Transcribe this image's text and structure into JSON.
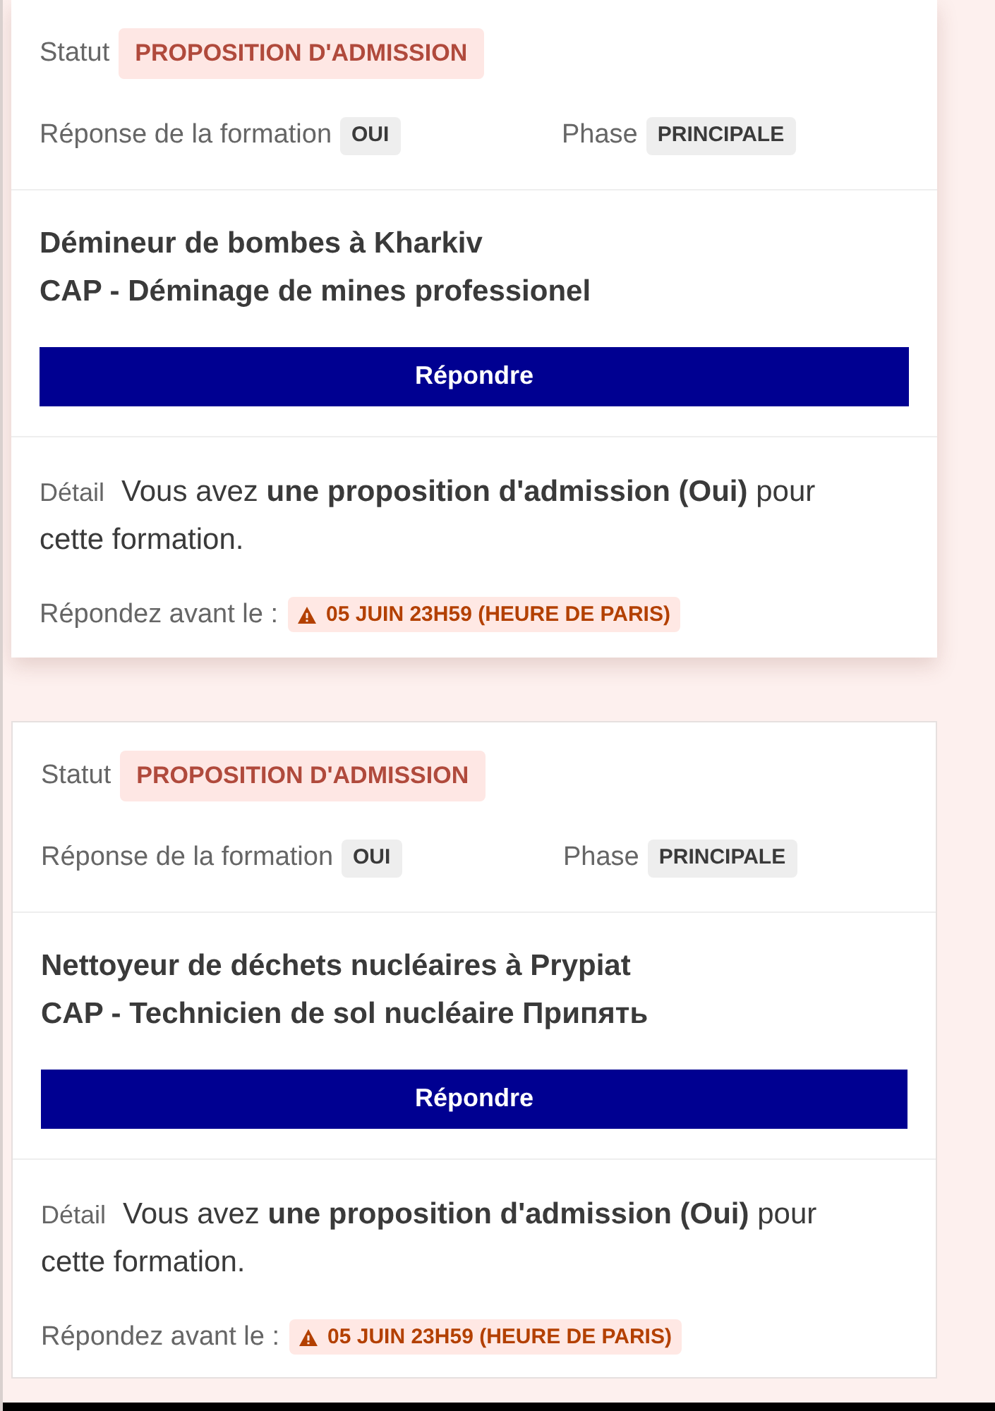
{
  "cards": [
    {
      "raised": true,
      "status": {
        "label": "Statut",
        "value": "PROPOSITION D'ADMISSION"
      },
      "response": {
        "label": "Réponse de la formation",
        "value": "OUI"
      },
      "phase": {
        "label": "Phase",
        "value": "PRINCIPALE"
      },
      "title": "Démineur de bombes à Kharkiv",
      "subtitle": "CAP - Déminage de mines professionel",
      "button": "Répondre",
      "detail": {
        "label": "Détail",
        "message": "Vous avez **une proposition d'admission (Oui)** pour cette formation."
      },
      "deadline": {
        "label": "Répondez avant le :",
        "value": "05 JUIN 23H59 (HEURE DE PARIS)"
      }
    },
    {
      "raised": false,
      "status": {
        "label": "Statut",
        "value": "PROPOSITION D'ADMISSION"
      },
      "response": {
        "label": "Réponse de la formation",
        "value": "OUI"
      },
      "phase": {
        "label": "Phase",
        "value": "PRINCIPALE"
      },
      "title": "Nettoyeur de déchets nucléaires à Prypiat",
      "subtitle": "CAP - Technicien de sol nucléaire Припять",
      "button": "Répondre",
      "detail": {
        "label": "Détail",
        "message": "Vous avez **une proposition d'admission (Oui)** pour cette formation."
      },
      "deadline": {
        "label": "Répondez avant le :",
        "value": "05 JUIN 23H59 (HEURE DE PARIS)"
      }
    }
  ]
}
